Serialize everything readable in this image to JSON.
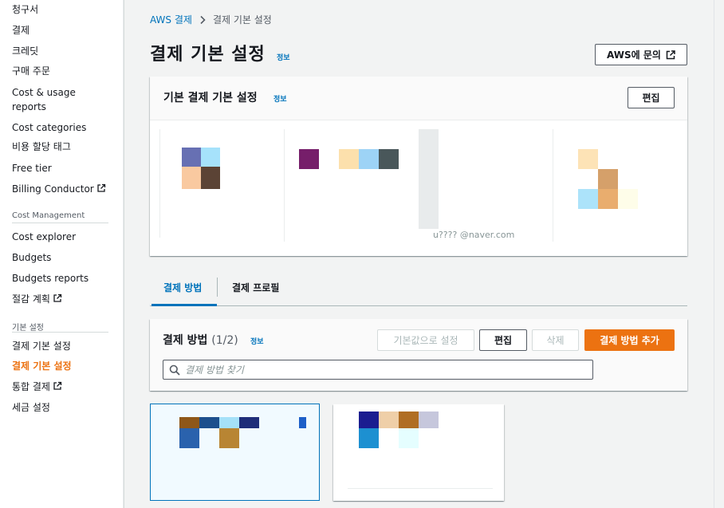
{
  "sidebar": {
    "items": [
      {
        "label": "청구서"
      },
      {
        "label": "결제"
      },
      {
        "label": "크레딧"
      },
      {
        "label": "구매 주문"
      },
      {
        "label": "Cost & usage"
      },
      {
        "label": "reports"
      },
      {
        "label": "Cost categories"
      },
      {
        "label": "비용 할당 태그"
      },
      {
        "label": "Free tier"
      },
      {
        "label": "Billing Conductor"
      }
    ],
    "section_cost_management": "Cost Management",
    "cost_items": [
      {
        "label": "Cost explorer"
      },
      {
        "label": "Budgets"
      },
      {
        "label": "Budgets reports"
      },
      {
        "label": "절감 계획"
      }
    ],
    "section_preferences": "기본 설정",
    "pref_items": [
      {
        "label": "결제 기본 설정"
      },
      {
        "label": "결제 기본 설정",
        "active": true
      },
      {
        "label": "통합 결제"
      },
      {
        "label": "세금 설정"
      }
    ]
  },
  "breadcrumb": {
    "parent": "AWS 결제",
    "current": "결제 기본 설정"
  },
  "page": {
    "title": "결제 기본 설정",
    "info": "정보",
    "contact_button": "AWS에 문의"
  },
  "default_settings": {
    "title": "기본 결제 기본 설정",
    "info": "정보",
    "edit_button": "편집",
    "email_partial": "u???? @naver.com"
  },
  "tabs": [
    {
      "label": "결제 방법",
      "active": true
    },
    {
      "label": "결제 프로필"
    }
  ],
  "payment_methods": {
    "title": "결제 방법",
    "count": "(1/2)",
    "info": "정보",
    "set_default_button": "기본값으로 설정",
    "edit_button": "편집",
    "delete_button": "삭제",
    "add_button": "결제 방법 추가",
    "search_placeholder": "결제 방법 찾기"
  },
  "colors": {
    "accent": "#ec7211",
    "link": "#0073bb"
  }
}
